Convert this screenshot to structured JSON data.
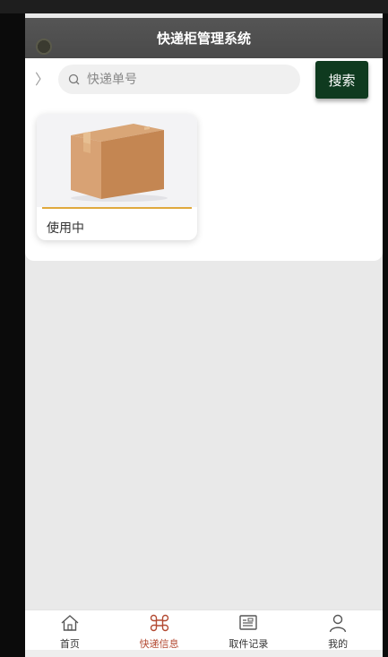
{
  "header": {
    "title": "快递柜管理系统"
  },
  "search": {
    "placeholder": "快递单号",
    "button_label": "搜索"
  },
  "cards": [
    {
      "status": "使用中"
    }
  ],
  "nav": {
    "items": [
      {
        "label": "首页",
        "icon": "home-icon"
      },
      {
        "label": "快递信息",
        "icon": "command-icon",
        "active": true
      },
      {
        "label": "取件记录",
        "icon": "record-icon"
      },
      {
        "label": "我的",
        "icon": "user-icon"
      }
    ]
  },
  "colors": {
    "accent": "#b34a32",
    "search_button": "#0f3a1f",
    "title_bar": "#4f4f4f",
    "card_underline": "#e0a93d"
  }
}
